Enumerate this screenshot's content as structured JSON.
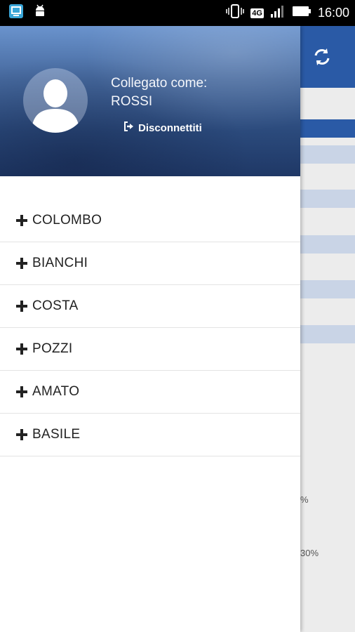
{
  "status_bar": {
    "time": "16:00",
    "network": "4G",
    "icons": [
      "screenshot-app-icon",
      "android-icon",
      "vibrate-icon",
      "signal-icon",
      "battery-icon"
    ]
  },
  "drawer": {
    "logged_in_label": "Collegato come:",
    "user_name": "ROSSI",
    "logout_label": "Disconnettiti",
    "items": [
      {
        "label": "COLOMBO"
      },
      {
        "label": "BIANCHI"
      },
      {
        "label": "COSTA"
      },
      {
        "label": "POZZI"
      },
      {
        "label": "AMATO"
      },
      {
        "label": "BASILE"
      }
    ]
  },
  "background_app": {
    "percent_1": "%",
    "percent_2": "30%"
  },
  "colors": {
    "toolbar": "#2a5aa6",
    "band_light": "#c9d4e6",
    "drawer_bg": "#ffffff"
  }
}
